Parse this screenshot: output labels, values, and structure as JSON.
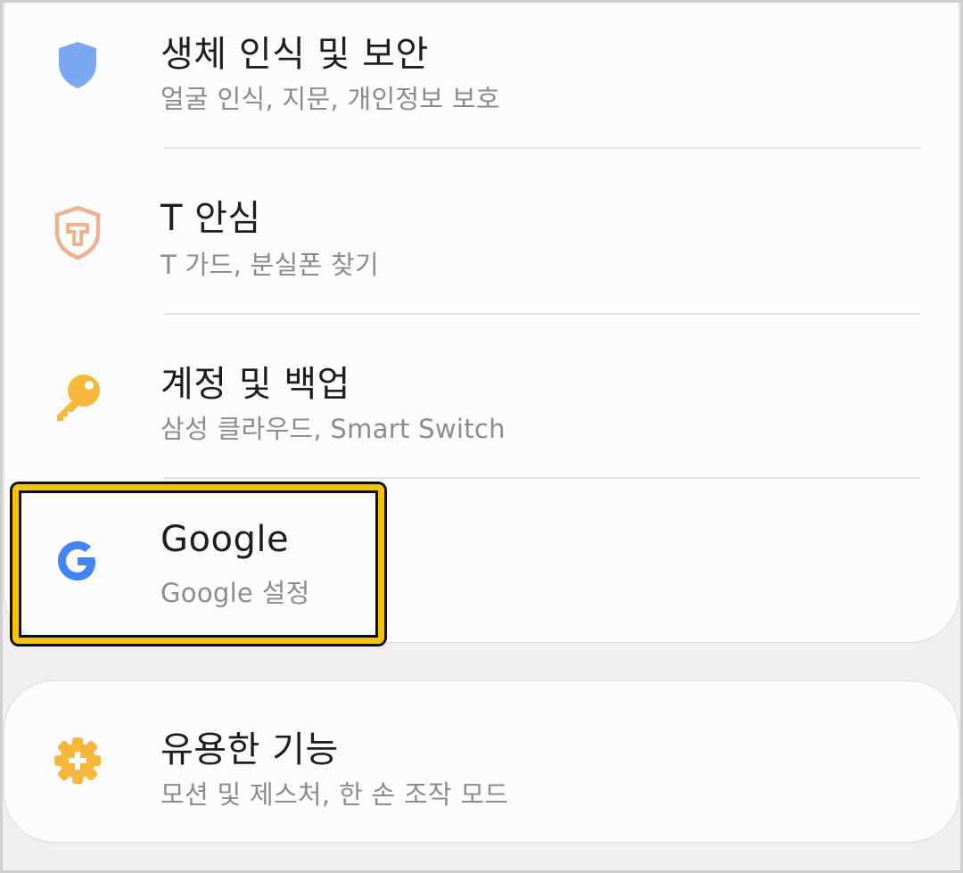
{
  "settings": {
    "items": [
      {
        "title": "생체 인식 및 보안",
        "subtitle": "얼굴 인식, 지문, 개인정보 보호",
        "icon": "shield-icon",
        "color": "#7aa6f2"
      },
      {
        "title": "T 안심",
        "subtitle": "T 가드, 분실폰 찾기",
        "icon": "t-shield-icon",
        "color": "#f0b28e"
      },
      {
        "title": "계정 및 백업",
        "subtitle": "삼성 클라우드, Smart Switch",
        "icon": "key-icon",
        "color": "#f5b83a"
      },
      {
        "title": "Google",
        "subtitle": "Google 설정",
        "icon": "google-icon",
        "color": "#4285f4",
        "highlighted": true
      },
      {
        "title": "유용한 기능",
        "subtitle": "모션 및 제스처, 한 손 조작 모드",
        "icon": "gear-plus-icon",
        "color": "#f6b73c"
      }
    ]
  },
  "highlight": {
    "color": "#f4c400"
  }
}
